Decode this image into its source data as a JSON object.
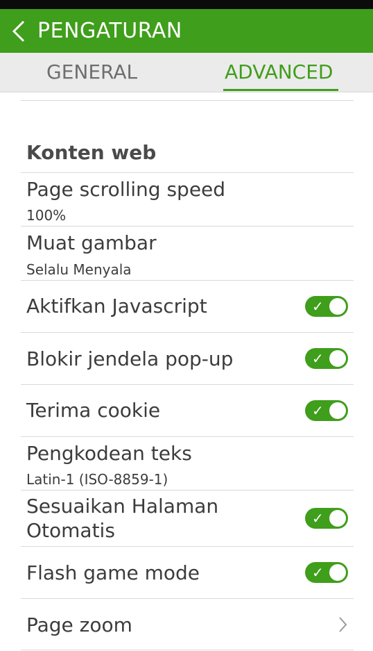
{
  "header": {
    "title": "PENGATURAN"
  },
  "tabs": [
    {
      "label": "GENERAL",
      "selected": false
    },
    {
      "label": "ADVANCED",
      "selected": true
    }
  ],
  "section": {
    "title": "Konten web"
  },
  "settings": {
    "scroll": {
      "title": "Page scrolling speed",
      "value": "100%"
    },
    "images": {
      "title": "Muat gambar",
      "value": "Selalu Menyala"
    },
    "javascript": {
      "title": "Aktifkan Javascript",
      "enabled": true
    },
    "popup": {
      "title": "Blokir jendela pop-up",
      "enabled": true
    },
    "cookie": {
      "title": "Terima cookie",
      "enabled": true
    },
    "encoding": {
      "title": "Pengkodean teks",
      "value": "Latin-1 (ISO-8859-1)"
    },
    "autofit": {
      "title_line1": "Sesuaikan Halaman",
      "title_line2": "Otomatis",
      "enabled": true
    },
    "flash": {
      "title": "Flash game mode",
      "enabled": true
    },
    "zoom": {
      "title": "Page zoom"
    }
  },
  "icons": {
    "back": "back-arrow-icon",
    "chevron": "chevron-right-icon",
    "check": "check-icon"
  },
  "colors": {
    "accent": "#3f9e1b",
    "tab_bg": "#ebebeb",
    "text": "#3c3c3c"
  }
}
